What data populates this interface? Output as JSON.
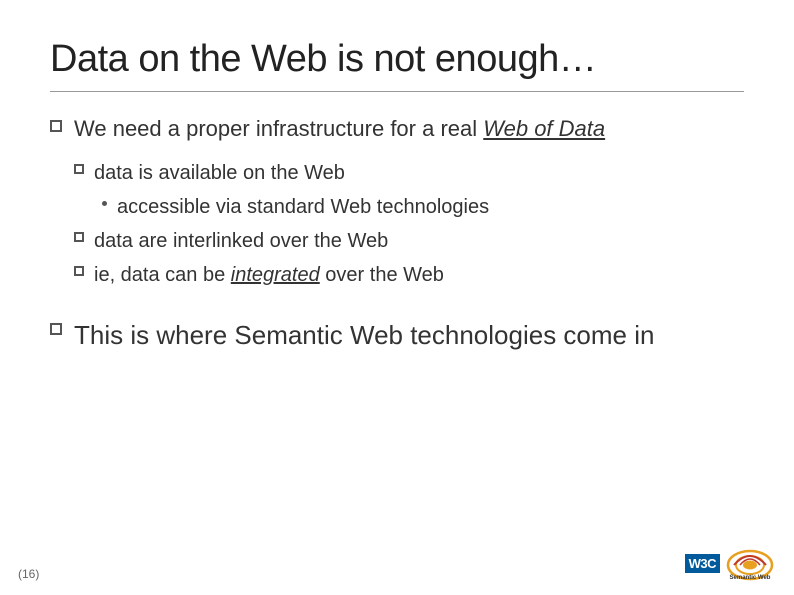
{
  "slide": {
    "title": "Data on the Web is not enough…",
    "main_bullet_1": {
      "prefix": "We need a proper infrastructure for a real ",
      "link_text": "Web of Data"
    },
    "sub_bullets": {
      "item1": {
        "label": "data is available on the Web",
        "sub_item": "accessible via standard Web technologies"
      },
      "item2": "data are interlinked over the Web",
      "item3_prefix": "ie, data can be ",
      "item3_link": "integrated",
      "item3_suffix": " over the Web"
    },
    "main_bullet_2_prefix": "This is where ",
    "main_bullet_2_emphasis": "Semantic Web technologies come in",
    "slide_number": "(16)"
  },
  "logo": {
    "w3c": "W3C",
    "semantic_web": "Semantic\nWeb"
  }
}
